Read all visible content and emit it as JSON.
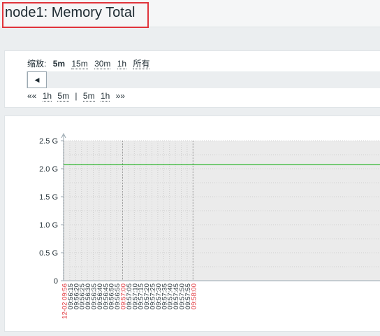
{
  "page_title": "node1: Memory Total",
  "zoom": {
    "label": "缩放:",
    "options": [
      {
        "label": "5m",
        "active": true
      },
      {
        "label": "15m",
        "active": false
      },
      {
        "label": "30m",
        "active": false
      },
      {
        "label": "1h",
        "active": false
      },
      {
        "label": "所有",
        "active": false
      }
    ]
  },
  "scroll_button_icon": "triangle-left-icon",
  "nav": {
    "back_all": "««",
    "back_1h": "1h",
    "back_5m": "5m",
    "separator": "|",
    "fwd_5m": "5m",
    "fwd_1h": "1h",
    "fwd_all": "»»"
  },
  "colors": {
    "series_line": "#00aa00",
    "highlight_tick": "#e0343b",
    "plot_background": "#ebebeb",
    "title_highlight_border": "#e0343b"
  },
  "chart_data": {
    "type": "line",
    "title": "",
    "y_ticks": [
      "0",
      "0.5 G",
      "1.0 G",
      "1.5 G",
      "2.0 G",
      "2.5 G"
    ],
    "ylim": [
      0,
      2.5
    ],
    "x_tick_labels": [
      {
        "label": "12-02 09:56",
        "major": true
      },
      {
        "label": "09:56:15",
        "major": false
      },
      {
        "label": "09:56:20",
        "major": false
      },
      {
        "label": "09:56:25",
        "major": false
      },
      {
        "label": "09:56:30",
        "major": false
      },
      {
        "label": "09:56:35",
        "major": false
      },
      {
        "label": "09:56:40",
        "major": false
      },
      {
        "label": "09:56:45",
        "major": false
      },
      {
        "label": "09:56:50",
        "major": false
      },
      {
        "label": "09:56:55",
        "major": false
      },
      {
        "label": "09:57:00",
        "major": true
      },
      {
        "label": "09:57:05",
        "major": false
      },
      {
        "label": "09:57:10",
        "major": false
      },
      {
        "label": "09:57:15",
        "major": false
      },
      {
        "label": "09:57:20",
        "major": false
      },
      {
        "label": "09:57:25",
        "major": false
      },
      {
        "label": "09:57:30",
        "major": false
      },
      {
        "label": "09:57:35",
        "major": false
      },
      {
        "label": "09:57:40",
        "major": false
      },
      {
        "label": "09:57:45",
        "major": false
      },
      {
        "label": "09:57:50",
        "major": false
      },
      {
        "label": "09:57:55",
        "major": false
      },
      {
        "label": "09:58:00",
        "major": true
      }
    ],
    "series": [
      {
        "values": [
          2.07,
          2.07,
          2.07,
          2.07,
          2.07,
          2.07,
          2.07,
          2.07,
          2.07,
          2.07,
          2.07,
          2.07,
          2.07,
          2.07,
          2.07,
          2.07,
          2.07,
          2.07,
          2.07,
          2.07,
          2.07,
          2.07,
          2.07
        ]
      }
    ],
    "grid": true
  }
}
